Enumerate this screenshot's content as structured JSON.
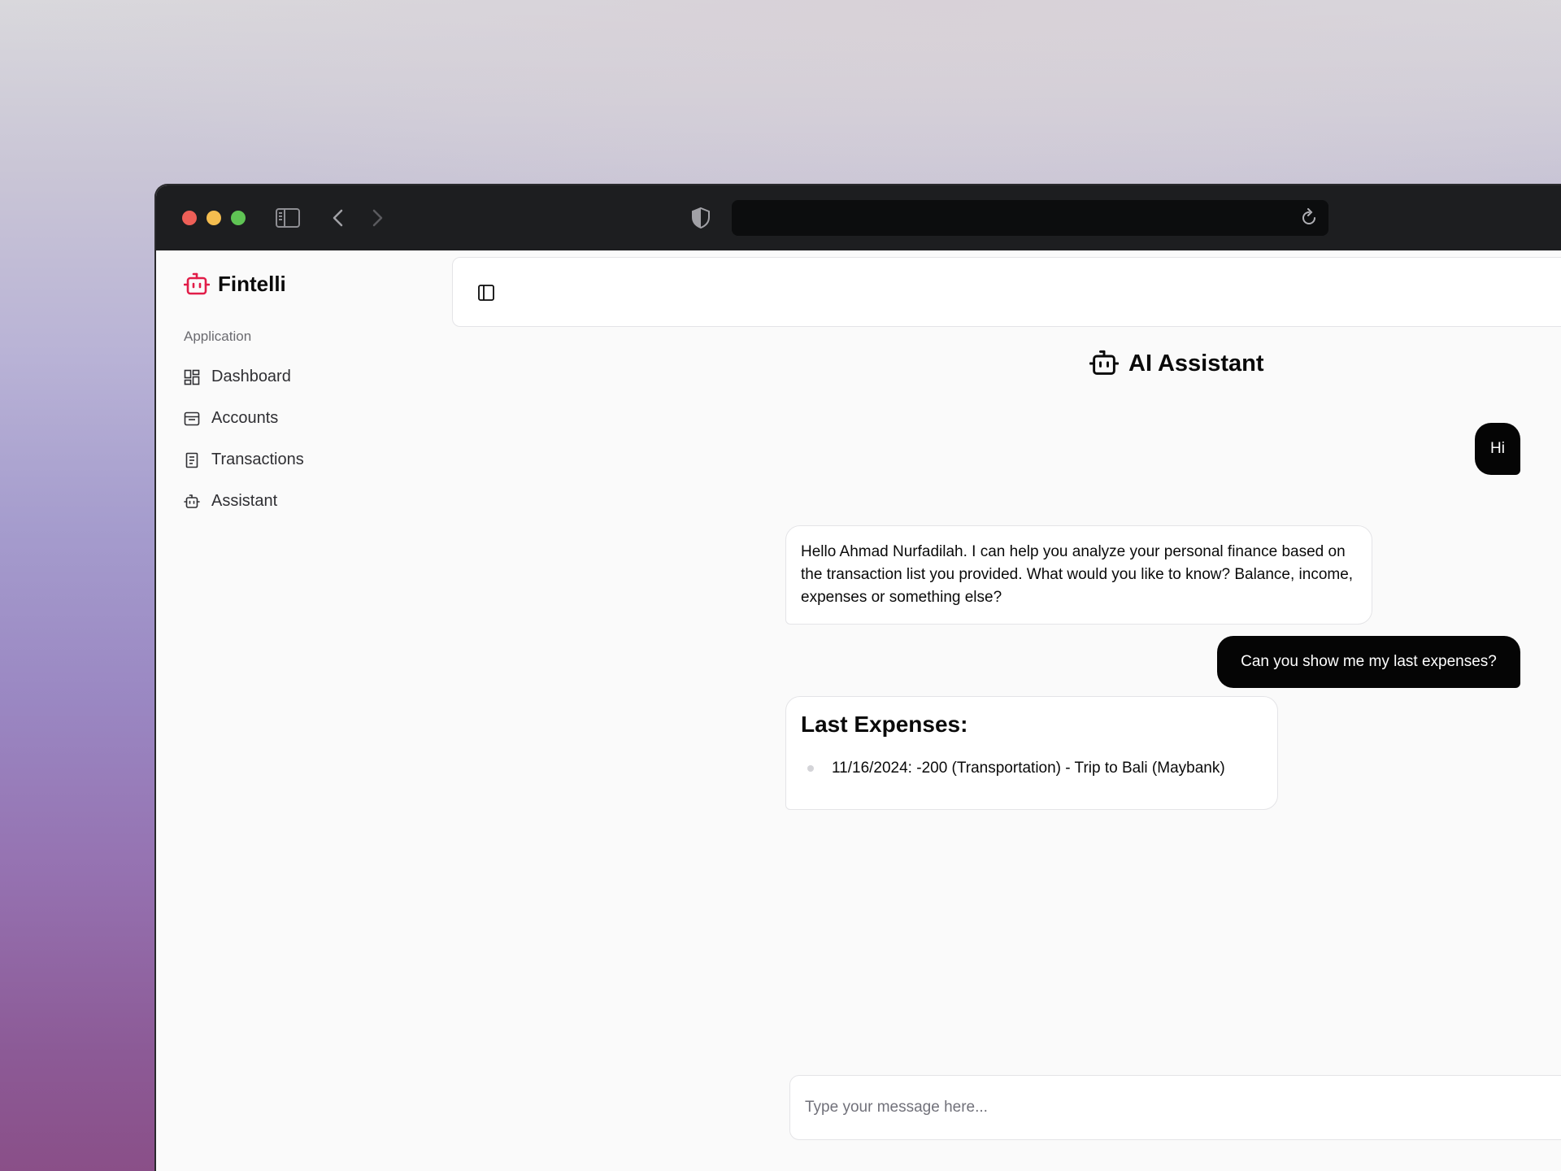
{
  "app": {
    "name": "Fintelli",
    "brand_color": "#e11d48"
  },
  "browser": {
    "url": ""
  },
  "sidebar": {
    "group_label": "Application",
    "items": [
      {
        "label": "Dashboard",
        "icon": "dashboard-icon"
      },
      {
        "label": "Accounts",
        "icon": "wallet-icon"
      },
      {
        "label": "Transactions",
        "icon": "receipt-icon"
      },
      {
        "label": "Assistant",
        "icon": "bot-icon"
      }
    ]
  },
  "main": {
    "title": "AI Assistant",
    "messages": [
      {
        "role": "user",
        "text": "Hi"
      },
      {
        "role": "assistant",
        "text": "Hello Ahmad Nurfadilah. I can help you analyze your personal finance based on the transaction list you provided. What would you like to know? Balance, income, expenses or something else?"
      },
      {
        "role": "user",
        "text": "Can you show me my last expenses?"
      },
      {
        "role": "assistant",
        "heading": "Last Expenses:",
        "items": [
          "11/16/2024: -200 (Transportation) - Trip to Bali (Maybank)"
        ]
      }
    ],
    "composer": {
      "placeholder": "Type your message here..."
    }
  }
}
